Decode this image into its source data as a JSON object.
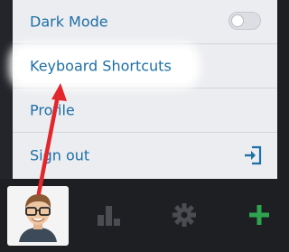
{
  "menu": {
    "items": [
      {
        "label": "Dark Mode"
      },
      {
        "label": "Keyboard Shortcuts"
      },
      {
        "label": "Profile"
      },
      {
        "label": "Sign out"
      }
    ]
  },
  "colors": {
    "accent": "#1d6fa5",
    "add": "#2ea44f",
    "annotation_arrow": "#e3262b",
    "menu_bg": "#ecedf0",
    "bar_bg": "#1e1f23"
  },
  "icons": [
    "toggle-switch",
    "sign-out-icon",
    "avatar",
    "bar-chart-icon",
    "gear-icon",
    "plus-icon"
  ]
}
